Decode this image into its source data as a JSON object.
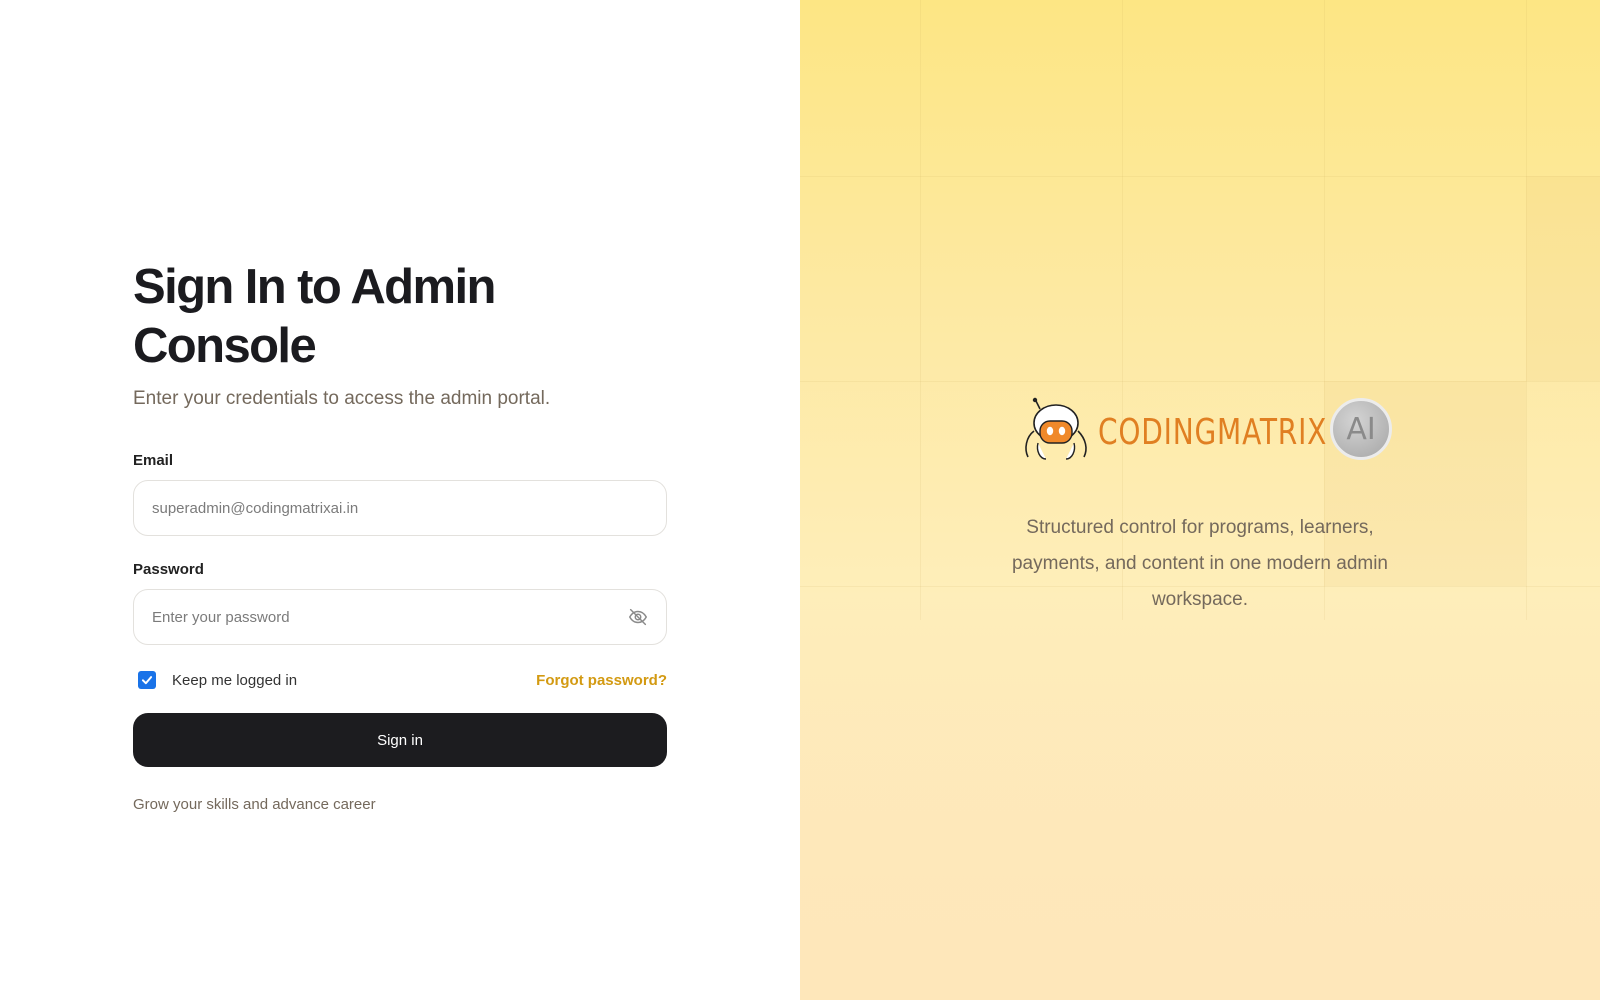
{
  "login": {
    "title": "Sign In to Admin Console",
    "subtitle": "Enter your credentials to access the admin portal.",
    "email_label": "Email",
    "email_placeholder": "superadmin@codingmatrixai.in",
    "password_label": "Password",
    "password_placeholder": "Enter your password",
    "keep_logged_in_label": "Keep me logged in",
    "keep_logged_in_checked": true,
    "forgot_password_label": "Forgot password?",
    "sign_in_label": "Sign in",
    "footer_text": "Grow your skills and advance career"
  },
  "brand": {
    "name": "CODINGMATRIX",
    "badge": "AI",
    "tagline": "Structured control for programs, learners, payments, and content in one modern admin workspace."
  },
  "icons": {
    "password_toggle": "eye-off-icon",
    "checkbox": "check-icon",
    "logo": "robot-mascot-icon"
  },
  "colors": {
    "primary_button": "#1c1c1f",
    "accent_link": "#d39a12",
    "checkbox": "#1a73e8",
    "brand_orange": "#e07f22",
    "panel_gradient_top": "#fde684",
    "panel_gradient_bottom": "#fee6bc"
  }
}
